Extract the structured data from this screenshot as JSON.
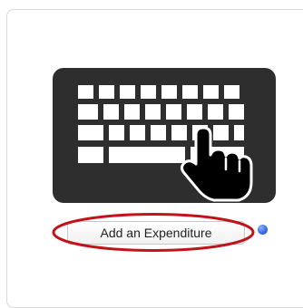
{
  "card": {
    "image": {
      "icon": "keyboard-with-hand-icon"
    },
    "button": {
      "label": "Add an Expenditure"
    },
    "info": {
      "icon": "info-icon"
    },
    "highlight": {
      "color": "#c0141b"
    }
  },
  "colors": {
    "keyboard_body": "#2e2e2e",
    "key": "#ffffff",
    "info_blue": "#3b6fe0"
  }
}
